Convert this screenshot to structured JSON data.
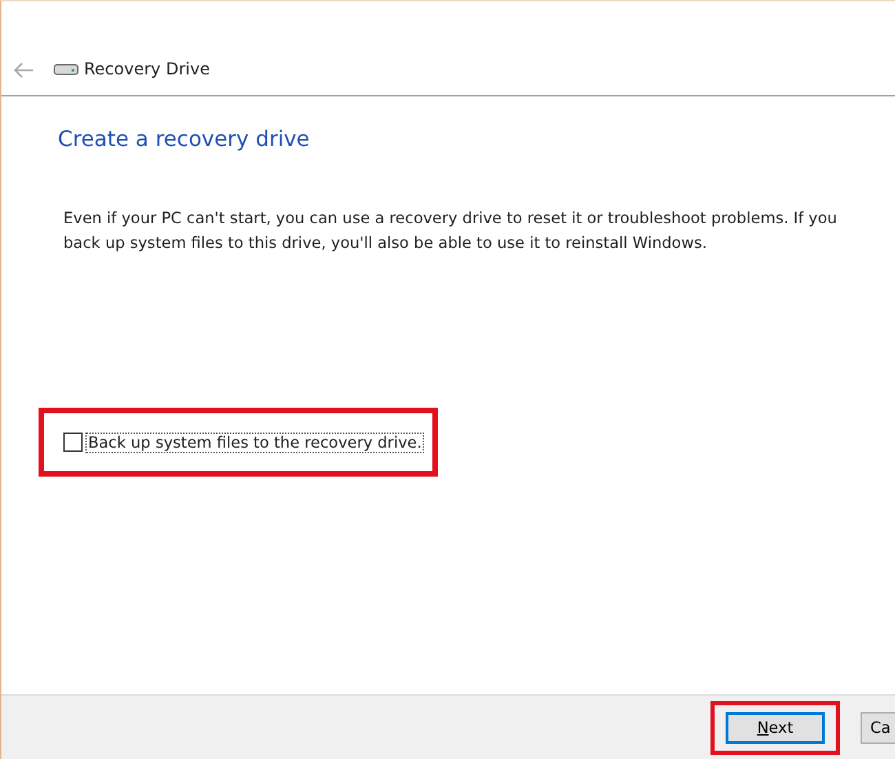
{
  "window": {
    "title": "Recovery Drive"
  },
  "heading": "Create a recovery drive",
  "description": "Even if your PC can't start, you can use a recovery drive to reset it or troubleshoot problems. If you back up system files to this drive, you'll also be able to use it to reinstall Windows.",
  "option": {
    "label": "Back up system files to the recovery drive.",
    "checked": false,
    "highlighted": true
  },
  "buttons": [
    {
      "label": "Next",
      "default": true,
      "highlighted": true
    },
    {
      "label": "Ca",
      "default": false,
      "highlighted": false
    }
  ]
}
